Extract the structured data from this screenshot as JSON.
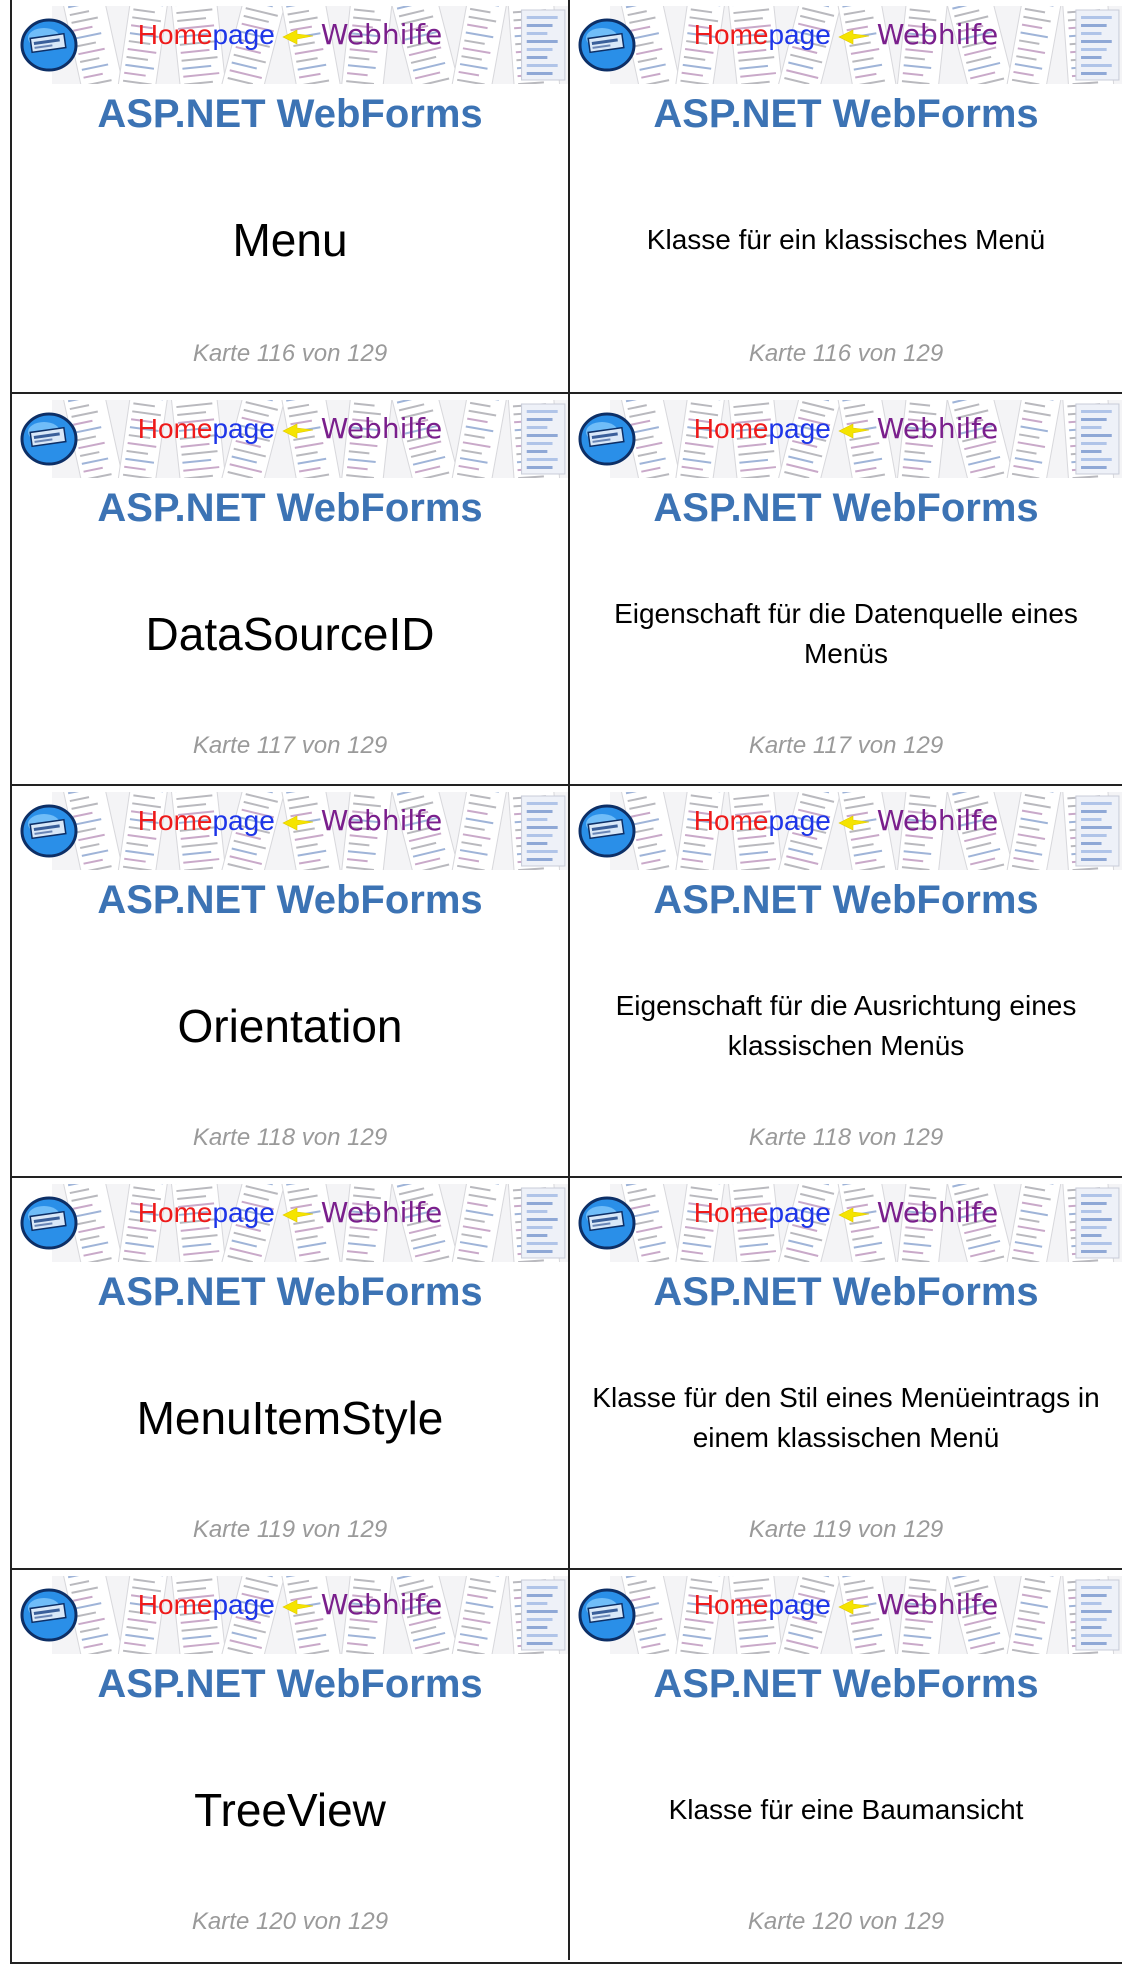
{
  "banner": {
    "home": "Home",
    "page": "page",
    "web": "Webhilfe"
  },
  "heading": "ASP.NET WebForms",
  "rows": [
    {
      "term": "Menu",
      "description": "Klasse für ein klassisches Menü",
      "footer": "Karte 116 von 129"
    },
    {
      "term": "DataSourceID",
      "description": "Eigenschaft für die Datenquelle eines Menüs",
      "footer": "Karte 117 von 129"
    },
    {
      "term": "Orientation",
      "description": "Eigenschaft für die Ausrichtung eines klassischen Menüs",
      "footer": "Karte 118 von 129"
    },
    {
      "term": "MenuItemStyle",
      "description": "Klasse für den Stil eines Menüeintrags in einem klassischen Menü",
      "footer": "Karte 119 von 129"
    },
    {
      "term": "TreeView",
      "description": "Klasse für eine Baumansicht",
      "footer": "Karte 120 von 129"
    }
  ],
  "colors": {
    "heading": "#3c73b4",
    "footer": "#9a9a9a",
    "home": "#ee1a1a",
    "page": "#1d35e8",
    "web": "#7a1f8c",
    "arrow": "#f5e400"
  }
}
